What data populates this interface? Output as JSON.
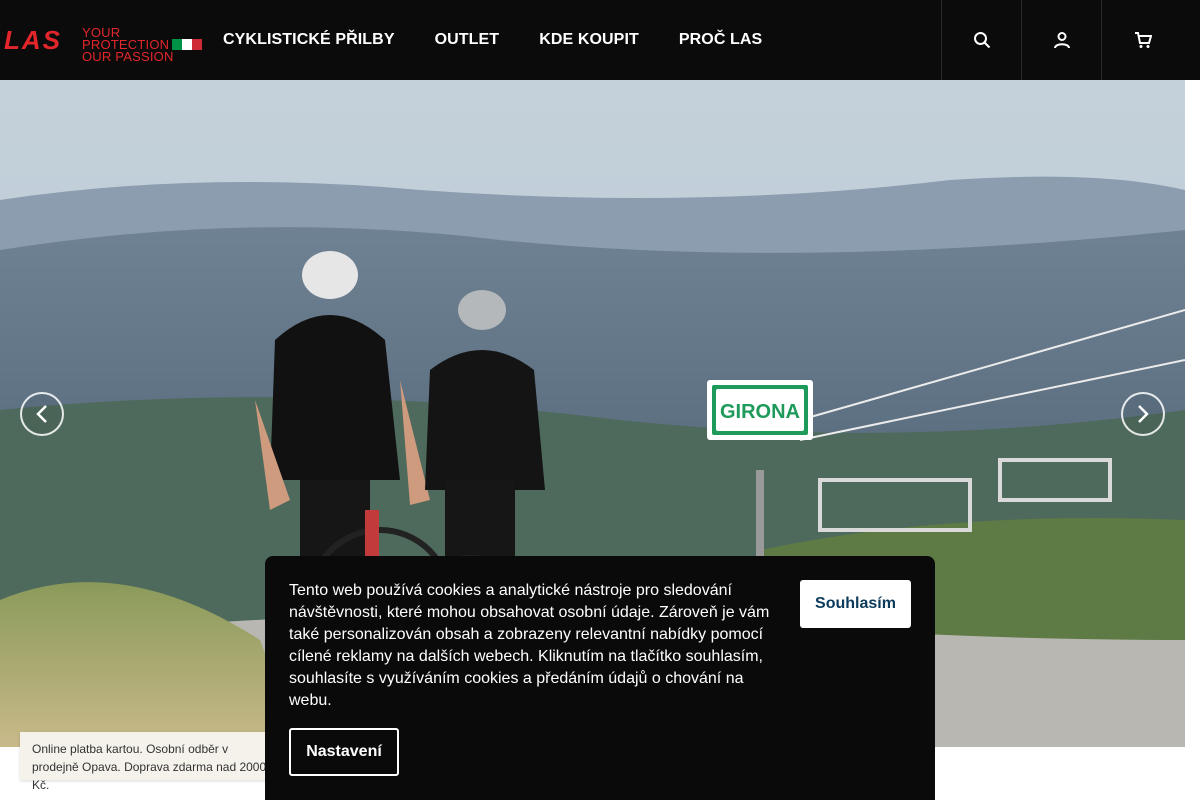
{
  "header": {
    "logo": {
      "brand": "LAS",
      "tagline_1": "YOUR PROTECTION",
      "tagline_2": "OUR PASSION",
      "flag_colors": [
        "#009246",
        "#ffffff",
        "#ce2b37"
      ]
    },
    "nav": [
      {
        "label": "CYKLISTICKÉ PŘILBY"
      },
      {
        "label": "OUTLET"
      },
      {
        "label": "KDE KOUPIT"
      },
      {
        "label": "PROČ LAS"
      }
    ],
    "icons": [
      "search-icon",
      "user-icon",
      "cart-icon"
    ]
  },
  "hero": {
    "sign": "GIRONA",
    "prev_icon": "chevron-left-icon",
    "next_icon": "chevron-right-icon"
  },
  "info_bar": {
    "text": "Online platba kartou. Osobní odběr v prodejně Opava. Doprava zdarma nad 2000 Kč."
  },
  "cookie_bar": {
    "text": "Tento web používá cookies a analytické nástroje pro sledování návštěvnosti, které mohou obsahovat osobní údaje. Zároveň je vám také personalizován obsah a zobrazeny relevantní nabídky pomocí cílené reklamy na dalších webech. Kliknutím na tlačítko souhlasím, souhlasíte s využíváním cookies a předáním údajů o chování na webu.",
    "accept_label": "Souhlasím",
    "settings_label": "Nastavení"
  },
  "colors": {
    "accent": "#e3262b",
    "header_bg": "#0b0b0b",
    "cookie_bg": "#0a0a0a"
  }
}
